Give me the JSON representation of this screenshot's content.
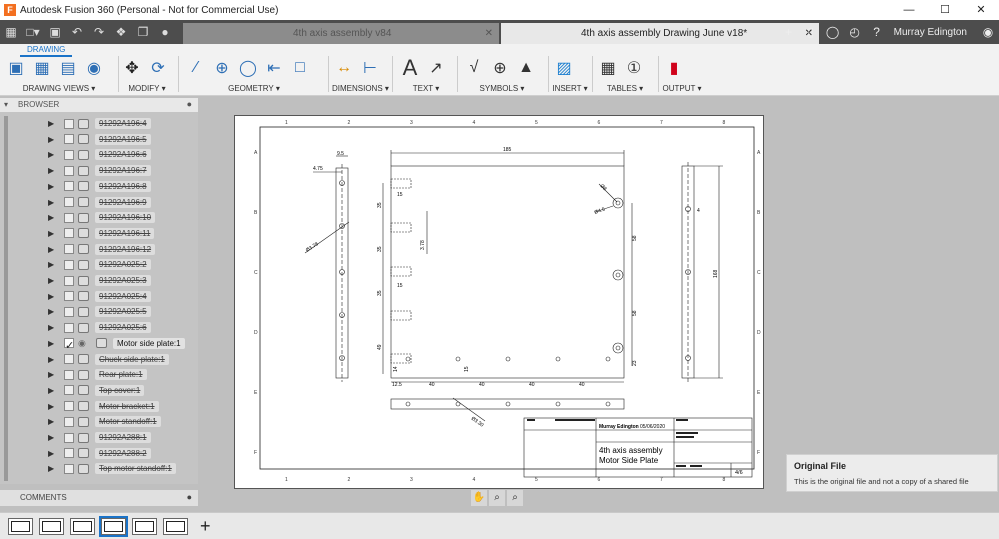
{
  "window": {
    "title": "Autodesk Fusion 360 (Personal - Not for Commercial Use)",
    "app_icon": "F",
    "minimize": "—",
    "maximize": "☐",
    "close": "✕"
  },
  "tabs": [
    {
      "label": "4th axis assembly v84",
      "active": false
    },
    {
      "label": "4th axis assembly Drawing June v18*",
      "active": true
    }
  ],
  "user": "Murray Edington",
  "ribbon": {
    "mode_tab": "DRAWING",
    "groups": [
      {
        "label": "DRAWING VIEWS ▾"
      },
      {
        "label": "MODIFY ▾"
      },
      {
        "label": "GEOMETRY ▾"
      },
      {
        "label": "DIMENSIONS ▾"
      },
      {
        "label": "TEXT ▾"
      },
      {
        "label": "SYMBOLS ▾"
      },
      {
        "label": "INSERT ▾"
      },
      {
        "label": "TABLES ▾"
      },
      {
        "label": "OUTPUT ▾"
      }
    ]
  },
  "browser": {
    "title": "BROWSER",
    "items": [
      {
        "label": "91292A196:4",
        "visible": false
      },
      {
        "label": "91292A196:5",
        "visible": false
      },
      {
        "label": "91292A196:6",
        "visible": false
      },
      {
        "label": "91292A196:7",
        "visible": false
      },
      {
        "label": "91292A196:8",
        "visible": false
      },
      {
        "label": "91292A196:9",
        "visible": false
      },
      {
        "label": "91292A196:10",
        "visible": false
      },
      {
        "label": "91292A196:11",
        "visible": false
      },
      {
        "label": "91292A196:12",
        "visible": false
      },
      {
        "label": "91292A025:2",
        "visible": false
      },
      {
        "label": "91292A025:3",
        "visible": false
      },
      {
        "label": "91292A025:4",
        "visible": false
      },
      {
        "label": "91292A025:5",
        "visible": false
      },
      {
        "label": "91292A025:6",
        "visible": false
      },
      {
        "label": "Motor side plate:1",
        "visible": true
      },
      {
        "label": "Chuck side plate:1",
        "visible": false
      },
      {
        "label": "Rear plate:1",
        "visible": false
      },
      {
        "label": "Top cover:1",
        "visible": false
      },
      {
        "label": "Motor bracket:1",
        "visible": false
      },
      {
        "label": "Motor standoff:1",
        "visible": false
      },
      {
        "label": "91292A288:1",
        "visible": false
      },
      {
        "label": "91292A288:2",
        "visible": false
      },
      {
        "label": "Top motor standoff:1",
        "visible": false
      }
    ]
  },
  "comments": {
    "title": "COMMENTS"
  },
  "drawing": {
    "border_numbers": [
      "1",
      "2",
      "3",
      "4",
      "5",
      "6",
      "7",
      "8"
    ],
    "border_letters": [
      "A",
      "B",
      "C",
      "D",
      "E",
      "F"
    ],
    "dims": {
      "top_width": "185",
      "left_a": "9.5",
      "left_b": "4.75",
      "left_dia": "Ø3.78",
      "v1": "35",
      "v2": "35",
      "v3": "35",
      "v4": "49",
      "h15a": "15",
      "h15b": "15",
      "d378": "3.78",
      "r58a": "58",
      "r58b": "58",
      "r23": "23",
      "dia8": "Ø8",
      "dia45": "Ø4.5",
      "b14": "14",
      "b15": "15",
      "b125": "12.5",
      "b40a": "40",
      "b40b": "40",
      "b40c": "40",
      "b40d": "40",
      "bottom_dia": "Ø3.30",
      "right_4": "4",
      "right_168": "168"
    },
    "title_block": {
      "author": "Murray Edington",
      "date": "05/06/2020",
      "line1": "4th axis assembly",
      "line2": "Motor Side Plate",
      "sheet": "4/6"
    }
  },
  "nav_tools": [
    "✋",
    "⌕",
    "⌕"
  ],
  "toast": {
    "title": "Original File",
    "body": "This is the original file and not a copy of a shared file"
  },
  "sheets": {
    "count": 6,
    "active_index": 3,
    "add_label": "+"
  }
}
